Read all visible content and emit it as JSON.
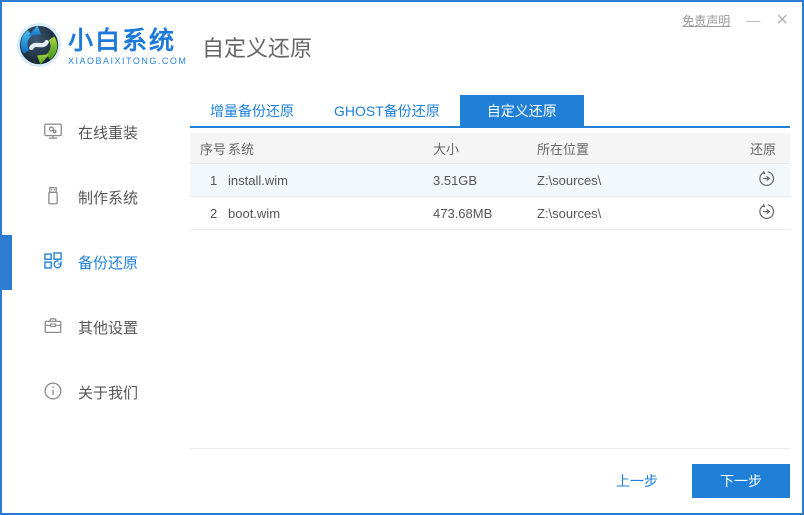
{
  "window": {
    "disclaimer": "免责声明",
    "minimize": "—",
    "close": "×"
  },
  "logo": {
    "title": "小白系统",
    "subtitle": "XIAOBAIXITONG.COM"
  },
  "page": {
    "title": "自定义还原"
  },
  "sidebar": {
    "items": [
      {
        "label": "在线重装",
        "icon": "monitor-icon",
        "active": false
      },
      {
        "label": "制作系统",
        "icon": "usb-drive-icon",
        "active": false
      },
      {
        "label": "备份还原",
        "icon": "backup-grid-icon",
        "active": true
      },
      {
        "label": "其他设置",
        "icon": "toolbox-icon",
        "active": false
      },
      {
        "label": "关于我们",
        "icon": "info-icon",
        "active": false
      }
    ]
  },
  "tabs": [
    {
      "label": "增量备份还原",
      "active": false
    },
    {
      "label": "GHOST备份还原",
      "active": false
    },
    {
      "label": "自定义还原",
      "active": true
    }
  ],
  "table": {
    "headers": {
      "index": "序号",
      "system": "系统",
      "size": "大小",
      "location": "所在位置",
      "restore": "还原"
    },
    "rows": [
      {
        "index": "1",
        "system": "install.wim",
        "size": "3.51GB",
        "location": "Z:\\sources\\"
      },
      {
        "index": "2",
        "system": "boot.wim",
        "size": "473.68MB",
        "location": "Z:\\sources\\"
      }
    ]
  },
  "footer": {
    "prev": "上一步",
    "next": "下一步"
  },
  "colors": {
    "primary": "#2080d8",
    "window_border": "#2e7bd2",
    "active_row_bg": "#f3f8fd",
    "sidebar_icon": "#8a8a8a"
  }
}
